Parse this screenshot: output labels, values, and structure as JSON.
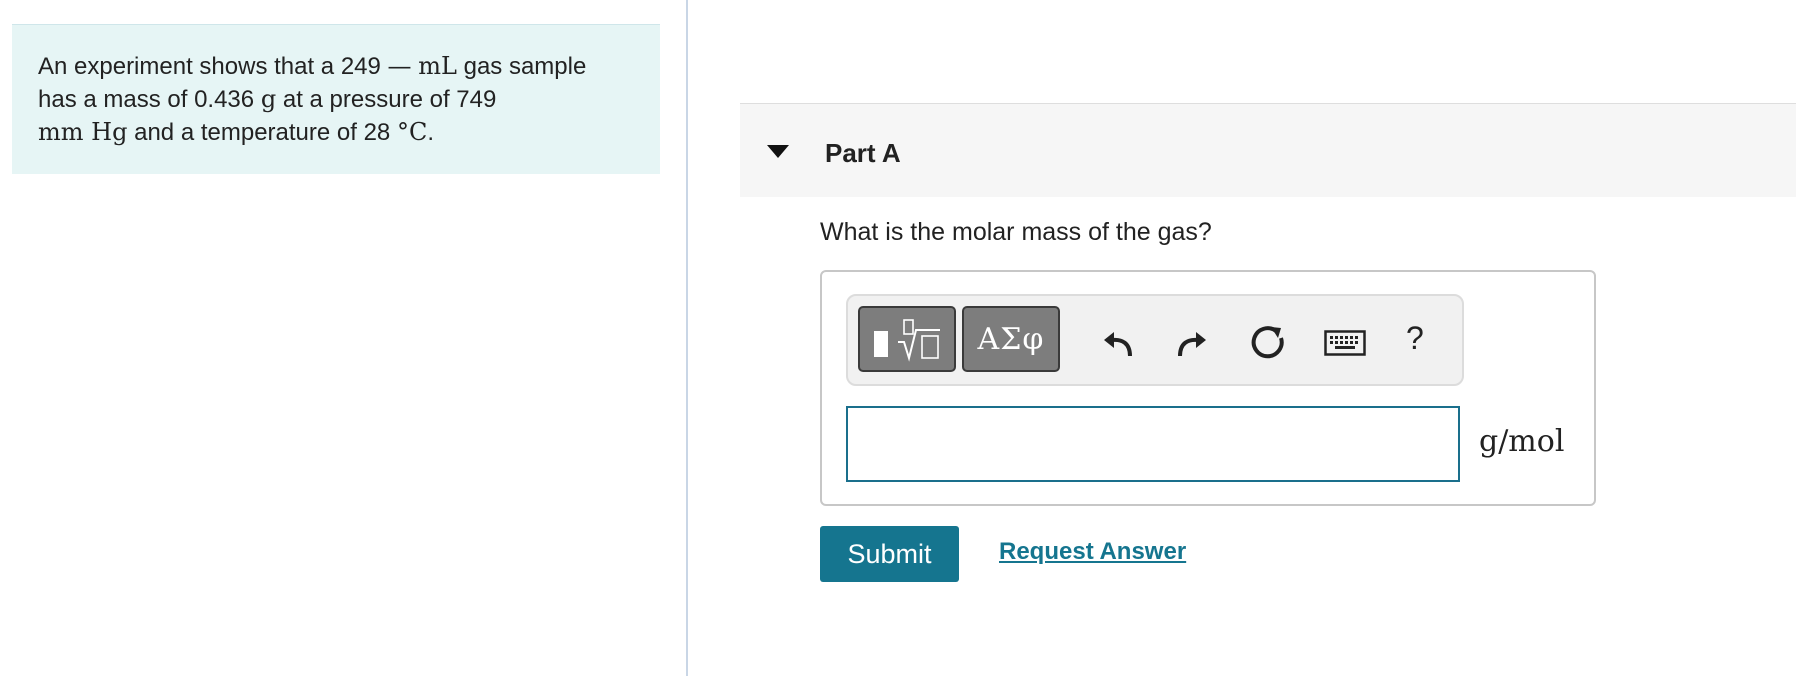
{
  "problem": {
    "line1_a": "An experiment shows that a 249",
    "line1_dash": "—",
    "line1_unit": "mL",
    "line1_b": "gas sample",
    "line2": "has a mass of 0.436",
    "line2_unit": "g",
    "line2_b": "at a pressure of 749",
    "line3_unit": "mm Hg",
    "line3_b": "and a temperature of 28",
    "line3_deg": "°C",
    "line3_end": "."
  },
  "part": {
    "title": "Part A"
  },
  "question": "What is the molar mass of the gas?",
  "toolbar": {
    "symbols_label": "ΑΣφ",
    "help_label": "?",
    "icons": [
      "templates-icon",
      "undo-icon",
      "redo-icon",
      "reset-icon",
      "keyboard-icon"
    ]
  },
  "answer": {
    "value": "",
    "unit": "g/mol"
  },
  "actions": {
    "submit_label": "Submit",
    "request_answer_label": "Request Answer"
  },
  "colors": {
    "accent": "#15758f",
    "problem_bg": "#e6f5f5"
  }
}
